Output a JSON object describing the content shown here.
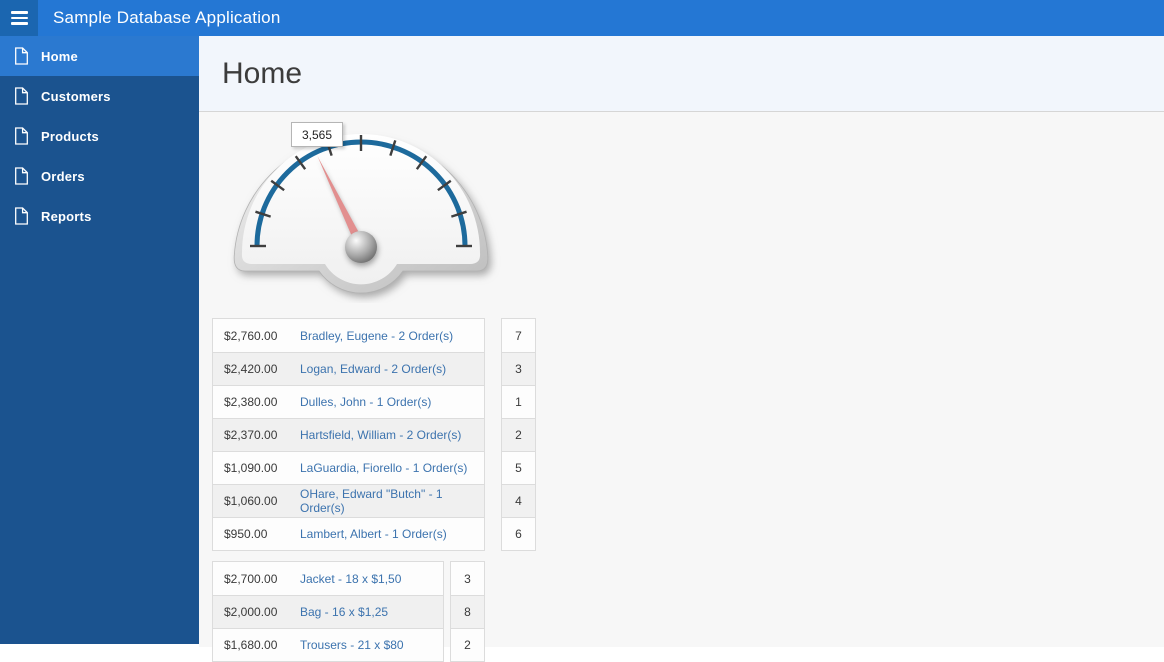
{
  "header": {
    "title": "Sample Database Application"
  },
  "sidebar": {
    "items": [
      {
        "label": "Home",
        "selected": true
      },
      {
        "label": "Customers",
        "selected": false
      },
      {
        "label": "Products",
        "selected": false
      },
      {
        "label": "Orders",
        "selected": false
      },
      {
        "label": "Reports",
        "selected": false
      }
    ]
  },
  "page": {
    "title": "Home"
  },
  "chart_data": {
    "type": "gauge",
    "value": 3565,
    "value_label": "3,565",
    "min": 0,
    "max": 10000,
    "major_tick_count": 11,
    "start_angle_deg": 180,
    "end_angle_deg": 0,
    "arc_color": "#1d6a9c",
    "needle_color": "#e28f8f"
  },
  "customers_table": {
    "rows": [
      {
        "amount": "$2,760.00",
        "link": "Bradley, Eugene - 2 Order(s)",
        "count": "7"
      },
      {
        "amount": "$2,420.00",
        "link": "Logan, Edward - 2 Order(s)",
        "count": "3"
      },
      {
        "amount": "$2,380.00",
        "link": "Dulles, John - 1 Order(s)",
        "count": "1"
      },
      {
        "amount": "$2,370.00",
        "link": "Hartsfield, William - 2 Order(s)",
        "count": "2"
      },
      {
        "amount": "$1,090.00",
        "link": "LaGuardia, Fiorello - 1 Order(s)",
        "count": "5"
      },
      {
        "amount": "$1,060.00",
        "link": "OHare, Edward \"Butch\" - 1 Order(s)",
        "count": "4"
      },
      {
        "amount": "$950.00",
        "link": "Lambert, Albert - 1 Order(s)",
        "count": "6"
      }
    ]
  },
  "products_table": {
    "rows": [
      {
        "amount": "$2,700.00",
        "link": "Jacket - 18 x $1,50",
        "count": "3"
      },
      {
        "amount": "$2,000.00",
        "link": "Bag - 16 x $1,25",
        "count": "8"
      },
      {
        "amount": "$1,680.00",
        "link": "Trousers - 21 x $80",
        "count": "2"
      }
    ]
  },
  "colors": {
    "header_bg": "#2477d4",
    "menu_tile_bg": "#1b66b0",
    "sidebar_bg": "#1b538f",
    "sidebar_selected_bg": "#2b79d0",
    "link_color": "#3c73ae"
  }
}
